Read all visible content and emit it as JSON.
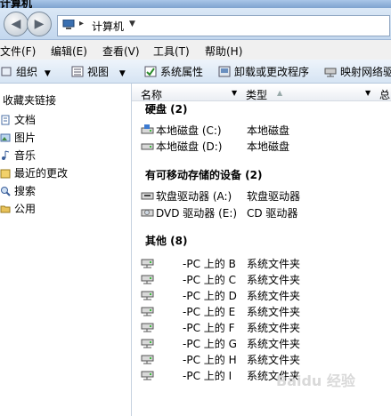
{
  "window": {
    "title": "计算机"
  },
  "address": {
    "path": "计算机"
  },
  "menu": [
    {
      "label": "文件(F)"
    },
    {
      "label": "编辑(E)"
    },
    {
      "label": "查看(V)"
    },
    {
      "label": "工具(T)"
    },
    {
      "label": "帮助(H)"
    }
  ],
  "toolbar": {
    "organize": "组织",
    "views": "视图",
    "system_props": "系统属性",
    "uninstall": "卸载或更改程序",
    "map_drive": "映射网络驱"
  },
  "nav": {
    "header": "收藏夹链接",
    "items": [
      {
        "label": "文档"
      },
      {
        "label": "图片"
      },
      {
        "label": "音乐"
      },
      {
        "label": "最近的更改"
      },
      {
        "label": "搜索"
      },
      {
        "label": "公用"
      }
    ]
  },
  "columns": {
    "name": "名称",
    "type": "类型",
    "extra": "总"
  },
  "groups": {
    "hdd": {
      "title": "硬盘 (2)",
      "items": [
        {
          "name": "本地磁盘 (C:)",
          "type": "本地磁盘"
        },
        {
          "name": "本地磁盘 (D:)",
          "type": "本地磁盘"
        }
      ]
    },
    "removable": {
      "title": "有可移动存储的设备 (2)",
      "items": [
        {
          "name": "软盘驱动器 (A:)",
          "type": "软盘驱动器"
        },
        {
          "name": "DVD 驱动器 (E:)",
          "type": "CD 驱动器"
        }
      ]
    },
    "other": {
      "title": "其他 (8)",
      "items": [
        {
          "name": "-PC 上的 B",
          "type": "系统文件夹"
        },
        {
          "name": "-PC 上的 C",
          "type": "系统文件夹"
        },
        {
          "name": "-PC 上的 D",
          "type": "系统文件夹"
        },
        {
          "name": "-PC 上的 E",
          "type": "系统文件夹"
        },
        {
          "name": "-PC 上的 F",
          "type": "系统文件夹"
        },
        {
          "name": "-PC 上的 G",
          "type": "系统文件夹"
        },
        {
          "name": "-PC 上的 H",
          "type": "系统文件夹"
        },
        {
          "name": "-PC 上的 I",
          "type": "系统文件夹"
        }
      ]
    }
  },
  "watermark": "Baidu 经验"
}
